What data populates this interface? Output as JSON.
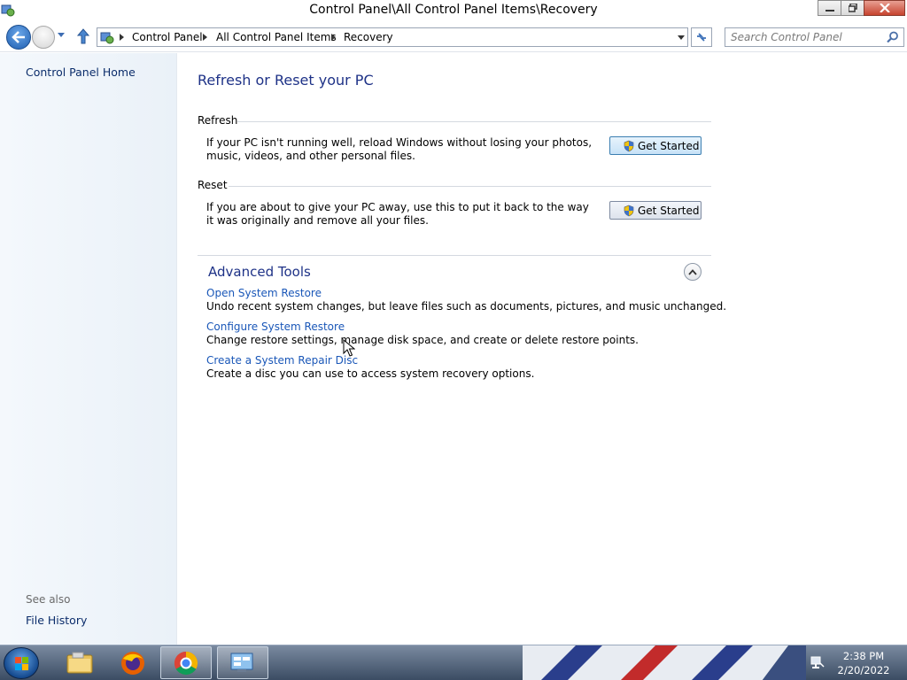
{
  "window": {
    "title": "Control Panel\\All Control Panel Items\\Recovery"
  },
  "address": {
    "crumbs": [
      "Control Panel",
      "All Control Panel Items",
      "Recovery"
    ]
  },
  "search": {
    "placeholder": "Search Control Panel"
  },
  "sidebar": {
    "home_link": "Control Panel Home",
    "see_also_label": "See also",
    "see_also_links": [
      "File History"
    ]
  },
  "main": {
    "title": "Refresh or Reset your PC",
    "refresh": {
      "label": "Refresh",
      "description": "If your PC isn't running well, reload Windows without losing your photos, music, videos, and other personal files.",
      "button": "Get Started"
    },
    "reset": {
      "label": "Reset",
      "description": "If you are about to give your PC away, use this to put it back to the way it was originally and remove all your files.",
      "button": "Get Started"
    },
    "advanced": {
      "title": "Advanced Tools",
      "items": [
        {
          "link": "Open System Restore",
          "description": "Undo recent system changes, but leave files such as documents, pictures, and music unchanged."
        },
        {
          "link": "Configure System Restore",
          "description": "Change restore settings, manage disk space, and create or delete restore points."
        },
        {
          "link": "Create a System Repair Disc",
          "description": "Create a disc you can use to access system recovery options."
        }
      ]
    }
  },
  "taskbar": {
    "apps": [
      "file-explorer",
      "firefox",
      "chrome",
      "control-panel"
    ],
    "clock_time": "2:38 PM",
    "clock_date": "2/20/2022"
  },
  "colors": {
    "link": "#1a57b8",
    "heading": "#1e3287",
    "sidebar_bg": "#eaf1f8"
  }
}
